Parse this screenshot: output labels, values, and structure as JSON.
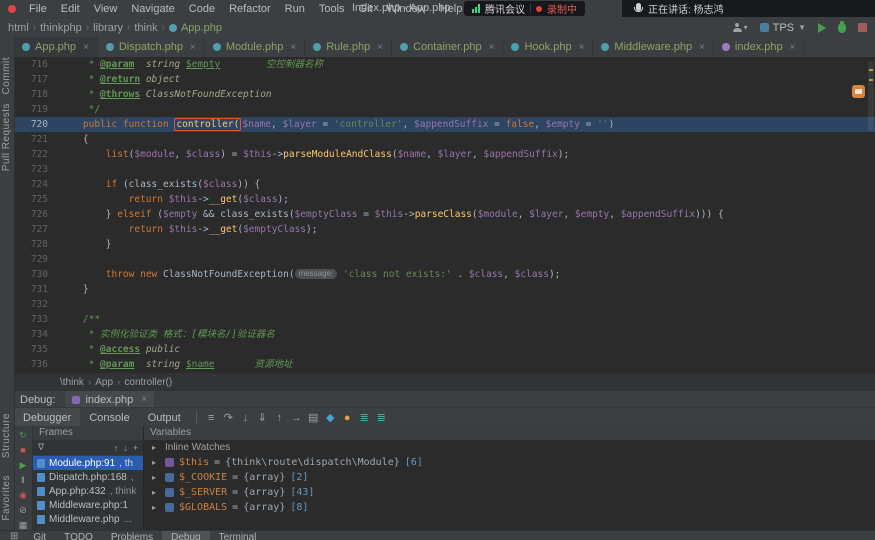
{
  "window": {
    "title": "Index.php - App.php",
    "menu": [
      "File",
      "Edit",
      "View",
      "Navigate",
      "Code",
      "Refactor",
      "Run",
      "Tools",
      "Git",
      "Window",
      "Help"
    ]
  },
  "overlay": {
    "meeting_app": "腾讯会议",
    "recording": "录制中",
    "speaking": "正在讲话: 杨志鸿"
  },
  "nav": {
    "path": [
      "html",
      "thinkphp",
      "library",
      "think"
    ],
    "file": "App.php"
  },
  "run": {
    "config": "TPS",
    "caret": "▼"
  },
  "tabs": [
    {
      "label": "App.php",
      "color": "#4e9fb0",
      "active": true
    },
    {
      "label": "Dispatch.php",
      "color": "#4e9fb0",
      "active": false
    },
    {
      "label": "Module.php",
      "color": "#4e9fb0",
      "active": false
    },
    {
      "label": "Rule.php",
      "color": "#4e9fb0",
      "active": false
    },
    {
      "label": "Container.php",
      "color": "#4e9fb0",
      "active": false
    },
    {
      "label": "Hook.php",
      "color": "#4e9fb0",
      "active": false
    },
    {
      "label": "Middleware.php",
      "color": "#4e9fb0",
      "active": false
    },
    {
      "label": "index.php",
      "color": "#9d7cc0",
      "active": false
    }
  ],
  "leftbar": {
    "top": [
      "Commit",
      "Pull Requests"
    ],
    "bottom": [
      "Structure",
      "Favorites"
    ]
  },
  "editor": {
    "breadcrumb": [
      "\\think",
      "App",
      "controller()"
    ],
    "lines": [
      {
        "n": "716",
        "hl": false,
        "segs": [
          [
            "c",
            "     * "
          ],
          [
            "ct",
            "@param"
          ],
          [
            "c",
            "  "
          ],
          [
            "ci",
            "string "
          ],
          [
            "cv",
            "$empty"
          ],
          [
            "c",
            "        "
          ],
          [
            "cc",
            "空控制器名称"
          ]
        ]
      },
      {
        "n": "717",
        "hl": false,
        "segs": [
          [
            "c",
            "     * "
          ],
          [
            "ct",
            "@return"
          ],
          [
            "c",
            " "
          ],
          [
            "ci",
            "object"
          ]
        ]
      },
      {
        "n": "718",
        "hl": false,
        "segs": [
          [
            "c",
            "     * "
          ],
          [
            "ct",
            "@throws"
          ],
          [
            "c",
            " "
          ],
          [
            "ci",
            "ClassNotFoundException"
          ]
        ]
      },
      {
        "n": "719",
        "hl": false,
        "segs": [
          [
            "c",
            "     */"
          ]
        ]
      },
      {
        "n": "720",
        "hl": true,
        "segs": [
          [
            "t",
            "    "
          ],
          [
            "k",
            "public"
          ],
          [
            "t",
            " "
          ],
          [
            "k",
            "function"
          ],
          [
            "t",
            " "
          ],
          [
            "box",
            "controller("
          ],
          [
            "v",
            "$name"
          ],
          [
            "t",
            ", "
          ],
          [
            "v",
            "$layer"
          ],
          [
            "t",
            " = "
          ],
          [
            "s",
            "'controller'"
          ],
          [
            "t",
            ", "
          ],
          [
            "v",
            "$appendSuffix"
          ],
          [
            "t",
            " = "
          ],
          [
            "k",
            "false"
          ],
          [
            "t",
            ", "
          ],
          [
            "v",
            "$empty"
          ],
          [
            "t",
            " = "
          ],
          [
            "s",
            "''"
          ],
          [
            "t",
            ")"
          ]
        ]
      },
      {
        "n": "721",
        "hl": false,
        "segs": [
          [
            "t",
            "    {"
          ]
        ]
      },
      {
        "n": "722",
        "hl": false,
        "segs": [
          [
            "t",
            "        "
          ],
          [
            "k",
            "list"
          ],
          [
            "t",
            "("
          ],
          [
            "v",
            "$module"
          ],
          [
            "t",
            ", "
          ],
          [
            "v",
            "$class"
          ],
          [
            "t",
            ") = "
          ],
          [
            "v",
            "$this"
          ],
          [
            "t",
            "->"
          ],
          [
            "m",
            "parseModuleAndClass"
          ],
          [
            "t",
            "("
          ],
          [
            "v",
            "$name"
          ],
          [
            "t",
            ", "
          ],
          [
            "v",
            "$layer"
          ],
          [
            "t",
            ", "
          ],
          [
            "v",
            "$appendSuffix"
          ],
          [
            "t",
            ");"
          ]
        ]
      },
      {
        "n": "723",
        "hl": false,
        "segs": []
      },
      {
        "n": "724",
        "hl": false,
        "segs": [
          [
            "t",
            "        "
          ],
          [
            "k",
            "if"
          ],
          [
            "t",
            " (class_exists("
          ],
          [
            "v",
            "$class"
          ],
          [
            "t",
            ")) {"
          ]
        ]
      },
      {
        "n": "725",
        "hl": false,
        "segs": [
          [
            "t",
            "            "
          ],
          [
            "k",
            "return"
          ],
          [
            "t",
            " "
          ],
          [
            "v",
            "$this"
          ],
          [
            "t",
            "->"
          ],
          [
            "m",
            "__get"
          ],
          [
            "t",
            "("
          ],
          [
            "v",
            "$class"
          ],
          [
            "t",
            ");"
          ]
        ]
      },
      {
        "n": "726",
        "hl": false,
        "segs": [
          [
            "t",
            "        } "
          ],
          [
            "k",
            "elseif"
          ],
          [
            "t",
            " ("
          ],
          [
            "v",
            "$empty"
          ],
          [
            "t",
            " && class_exists("
          ],
          [
            "v",
            "$emptyClass"
          ],
          [
            "t",
            " = "
          ],
          [
            "v",
            "$this"
          ],
          [
            "t",
            "->"
          ],
          [
            "m",
            "parseClass"
          ],
          [
            "t",
            "("
          ],
          [
            "v",
            "$module"
          ],
          [
            "t",
            ", "
          ],
          [
            "v",
            "$layer"
          ],
          [
            "t",
            ", "
          ],
          [
            "v",
            "$empty"
          ],
          [
            "t",
            ", "
          ],
          [
            "v",
            "$appendSuffix"
          ],
          [
            "t",
            "))) {"
          ]
        ]
      },
      {
        "n": "727",
        "hl": false,
        "segs": [
          [
            "t",
            "            "
          ],
          [
            "k",
            "return"
          ],
          [
            "t",
            " "
          ],
          [
            "v",
            "$this"
          ],
          [
            "t",
            "->"
          ],
          [
            "m",
            "__get"
          ],
          [
            "t",
            "("
          ],
          [
            "v",
            "$emptyClass"
          ],
          [
            "t",
            ");"
          ]
        ]
      },
      {
        "n": "728",
        "hl": false,
        "segs": [
          [
            "t",
            "        }"
          ]
        ]
      },
      {
        "n": "729",
        "hl": false,
        "segs": []
      },
      {
        "n": "730",
        "hl": false,
        "segs": [
          [
            "t",
            "        "
          ],
          [
            "k",
            "throw"
          ],
          [
            "t",
            " "
          ],
          [
            "k",
            "new"
          ],
          [
            "t",
            " ClassNotFoundException("
          ],
          [
            "chip",
            "message:"
          ],
          [
            "t",
            " "
          ],
          [
            "s",
            "'class not exists:'"
          ],
          [
            "t",
            " . "
          ],
          [
            "v",
            "$class"
          ],
          [
            "t",
            ", "
          ],
          [
            "v",
            "$class"
          ],
          [
            "t",
            ");"
          ]
        ]
      },
      {
        "n": "731",
        "hl": false,
        "segs": [
          [
            "t",
            "    }"
          ]
        ]
      },
      {
        "n": "732",
        "hl": false,
        "segs": []
      },
      {
        "n": "733",
        "hl": false,
        "segs": [
          [
            "c",
            "    /**"
          ]
        ]
      },
      {
        "n": "734",
        "hl": false,
        "segs": [
          [
            "c",
            "     * "
          ],
          [
            "cc",
            "实例化验证类 格式：[模块名/]验证器名"
          ]
        ]
      },
      {
        "n": "735",
        "hl": false,
        "segs": [
          [
            "c",
            "     * "
          ],
          [
            "ct",
            "@access"
          ],
          [
            "c",
            " "
          ],
          [
            "ci",
            "public"
          ]
        ]
      },
      {
        "n": "736",
        "hl": false,
        "segs": [
          [
            "c",
            "     * "
          ],
          [
            "ct",
            "@param"
          ],
          [
            "c",
            "  "
          ],
          [
            "ci",
            "string "
          ],
          [
            "cv",
            "$name"
          ],
          [
            "c",
            "       "
          ],
          [
            "cc",
            "资源地址"
          ]
        ]
      }
    ]
  },
  "debug": {
    "label": "Debug:",
    "tab": "index.php",
    "views": [
      {
        "label": "Debugger",
        "selected": true
      },
      {
        "label": "Console",
        "selected": false
      },
      {
        "label": "Output",
        "selected": false
      }
    ],
    "toolbar_icons": [
      {
        "name": "show-execution-point-icon",
        "glyph": "≡",
        "color": "#9da0a6"
      },
      {
        "name": "step-over-icon",
        "glyph": "↷",
        "color": "#9da0a6"
      },
      {
        "name": "step-into-icon",
        "glyph": "↓",
        "color": "#9da0a6"
      },
      {
        "name": "force-step-into-icon",
        "glyph": "⇓",
        "color": "#9da0a6"
      },
      {
        "name": "step-out-icon",
        "glyph": "↑",
        "color": "#9da0a6"
      },
      {
        "name": "run-to-cursor-icon",
        "glyph": "→",
        "color": "#9da0a6"
      },
      {
        "name": "view-options-icon",
        "glyph": "▤",
        "color": "#9da0a6"
      },
      {
        "name": "settings-icon",
        "glyph": "◆",
        "color": "#4b9fd5"
      },
      {
        "name": "mute-breakpoints-icon",
        "glyph": "●",
        "color": "#d9a343"
      },
      {
        "name": "evaluate-icon",
        "glyph": "≣",
        "color": "#4ba8a0"
      },
      {
        "name": "add-watch-icon",
        "glyph": "≣",
        "color": "#4ba8a0"
      }
    ],
    "strip_icons": [
      {
        "name": "rerun-icon",
        "glyph": "↻",
        "color": "#499c54"
      },
      {
        "name": "stop-icon",
        "glyph": "■",
        "color": "#c75450"
      },
      {
        "name": "resume-icon",
        "glyph": "▶",
        "color": "#499c54"
      },
      {
        "name": "pause-icon",
        "glyph": "‖",
        "color": "#9da0a6"
      },
      {
        "name": "view-breakpoints-icon",
        "glyph": "◉",
        "color": "#c75450"
      },
      {
        "name": "mute-all-breakpoints-icon",
        "glyph": "⊘",
        "color": "#9da0a6"
      },
      {
        "name": "restore-layout-icon",
        "glyph": "▦",
        "color": "#9da0a6"
      }
    ],
    "frames": {
      "title": "Frames",
      "toolbar": {
        "filter": "∇",
        "up": "↑",
        "down": "↓",
        "add": "+"
      },
      "items": [
        {
          "main": "Module.php:91",
          "sub": ", th",
          "selected": true
        },
        {
          "main": "Dispatch.php:168",
          "sub": ",",
          "selected": false
        },
        {
          "main": "App.php:432",
          "sub": ", think",
          "selected": false
        },
        {
          "main": "Middleware.php:1",
          "sub": "",
          "selected": false
        },
        {
          "main": "Middleware.php",
          "sub": "...",
          "selected": false
        }
      ]
    },
    "variables": {
      "title": "Variables",
      "watches_label": "Inline Watches",
      "items": [
        {
          "name": "$this",
          "value": "{think\\route\\dispatch\\Module}",
          "count": "[6]",
          "icon_color": "#71589c"
        },
        {
          "name": "$_COOKIE",
          "value": "{array}",
          "count": "[2]",
          "icon_color": "#49699c"
        },
        {
          "name": "$_SERVER",
          "value": "{array}",
          "count": "[43]",
          "icon_color": "#49699c"
        },
        {
          "name": "$GLOBALS",
          "value": "{array}",
          "count": "[8]",
          "icon_color": "#49699c"
        }
      ]
    }
  },
  "statusbar": {
    "grid_glyph": "⊞",
    "items": [
      {
        "label": "Git",
        "active": false
      },
      {
        "label": "TODO",
        "active": false
      },
      {
        "label": "Problems",
        "active": false
      },
      {
        "label": "Debug",
        "active": true
      },
      {
        "label": "Terminal",
        "active": false
      }
    ]
  }
}
